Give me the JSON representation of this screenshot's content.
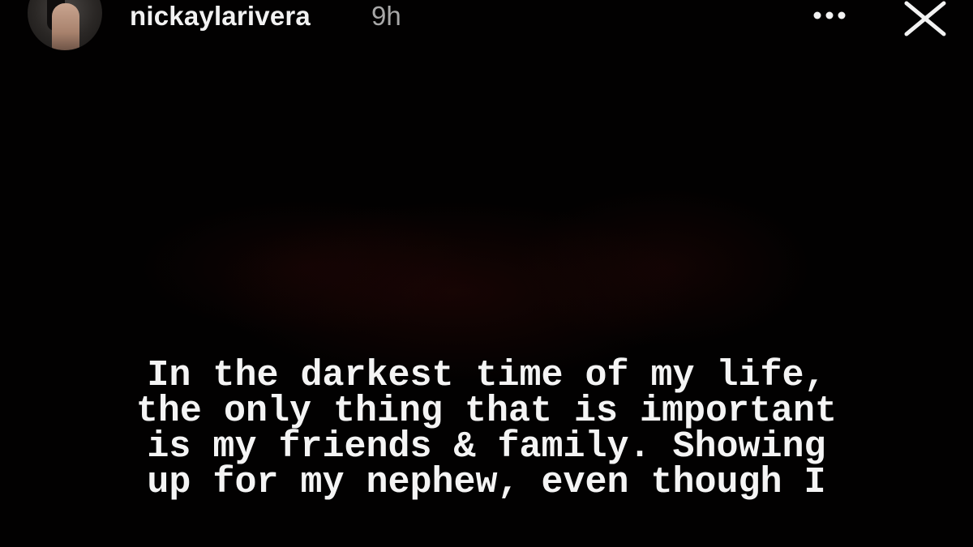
{
  "story": {
    "username": "nickaylarivera",
    "timestamp": "9h",
    "caption": "In the darkest time of my life,\nthe only thing that is important\nis my friends & family. Showing\nup for my nephew, even though I"
  },
  "icons": {
    "more": "more-horizontal-icon",
    "close": "close-icon",
    "avatar": "profile-avatar"
  },
  "colors": {
    "background": "#020101",
    "text": "#f4f4f4",
    "timestamp": "#a8a8a8"
  }
}
